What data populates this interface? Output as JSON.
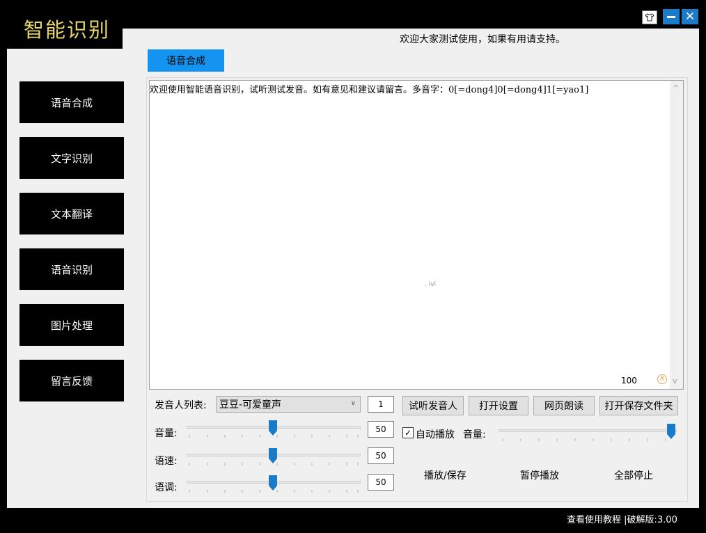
{
  "app": {
    "title": "智能识别",
    "welcome": "欢迎大家测试使用，如果有用请支持。"
  },
  "window_controls": {
    "skin_icon": "shirt-icon",
    "minimize_icon": "minimize-icon",
    "close_icon": "close-icon",
    "close_glyph": "✕"
  },
  "tab": {
    "label": "语音合成"
  },
  "sidebar": {
    "items": [
      {
        "label": "语音合成"
      },
      {
        "label": "文字识别"
      },
      {
        "label": "文本翻译"
      },
      {
        "label": "语音识别"
      },
      {
        "label": "图片处理"
      },
      {
        "label": "留言反馈"
      }
    ]
  },
  "editor": {
    "text": "欢迎使用智能语音识别，试听测试发音。如有意见和建议请留言。多音字：0[=dong4]0[=dong4]1[=yao1]",
    "watermark": ". ivi",
    "zoom": "100",
    "zoom_reset_glyph": "✕",
    "scroll_up_glyph": "^",
    "scroll_down_glyph": "v"
  },
  "voice": {
    "label": "发音人列表:",
    "selected": "豆豆-可爱童声",
    "chevron_glyph": "∨",
    "count": "1"
  },
  "buttons": {
    "listen": "试听发音人",
    "open_settings": "打开设置",
    "web_read": "网页朗读",
    "open_save_folder": "打开保存文件夹",
    "play_save": "播放/保存",
    "pause": "暂停播放",
    "stop_all": "全部停止"
  },
  "sliders": {
    "volume": {
      "label": "音量:",
      "value": "50",
      "level": 0.5
    },
    "speed": {
      "label": "语速:",
      "value": "50",
      "level": 0.5
    },
    "pitch": {
      "label": "语调:",
      "value": "50",
      "level": 0.5
    }
  },
  "autoplay": {
    "check_glyph": "✓",
    "label": "自动播放",
    "volume_label": "音量:",
    "volume_level": 1.0
  },
  "status": {
    "text": "查看使用教程 |破解版:3.00"
  },
  "colors": {
    "accent_blue": "#1593f0",
    "thumb_blue": "#1a7cc8",
    "title_gold": "#e6d66a"
  }
}
